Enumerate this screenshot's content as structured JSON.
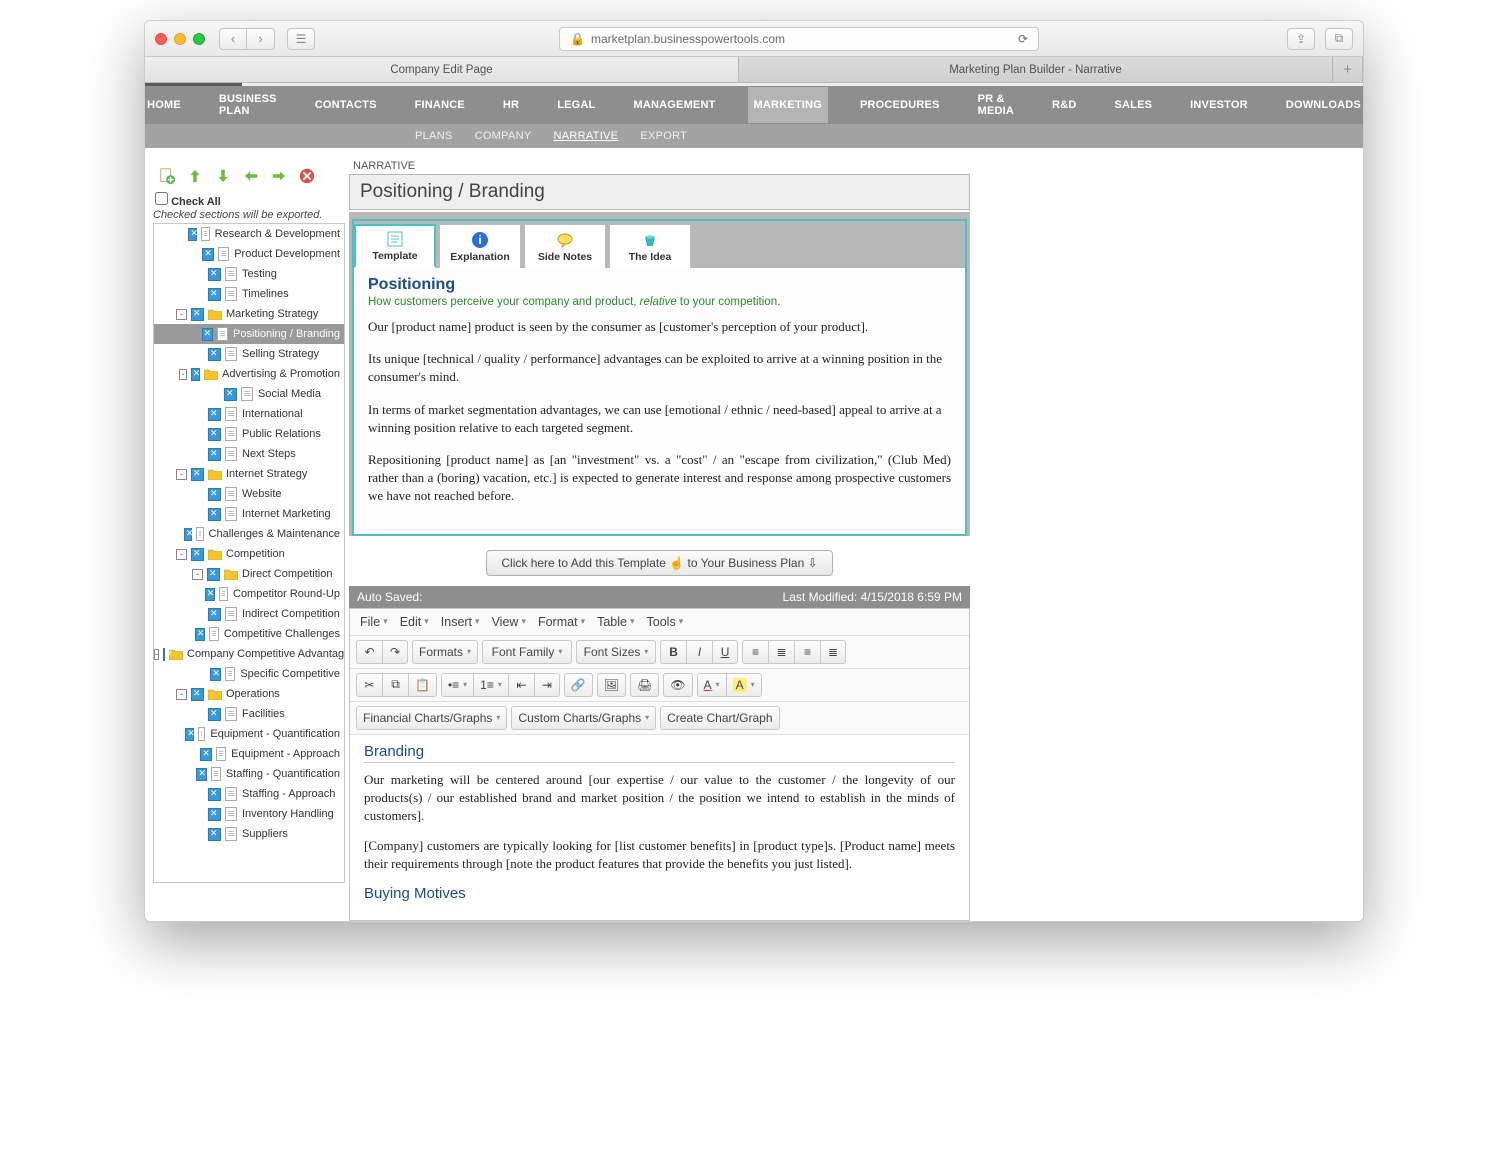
{
  "browser": {
    "url": "marketplan.businesspowertools.com",
    "tabs": [
      "Company Edit Page",
      "Marketing Plan Builder - Narrative"
    ]
  },
  "mainnav": [
    "HOME",
    "BUSINESS PLAN",
    "CONTACTS",
    "FINANCE",
    "HR",
    "LEGAL",
    "MANAGEMENT",
    "MARKETING",
    "PROCEDURES",
    "PR & MEDIA",
    "R&D",
    "SALES",
    "INVESTOR",
    "DOWNLOADS"
  ],
  "mainnav_active": 7,
  "subnav": [
    "PLANS",
    "COMPANY",
    "NARRATIVE",
    "EXPORT"
  ],
  "subnav_active": 2,
  "sidebar": {
    "check_all": "Check All",
    "hint": "Checked sections will be exported.",
    "tree": [
      {
        "d": 3,
        "t": "doc",
        "label": "Research & Development"
      },
      {
        "d": 3,
        "t": "doc",
        "label": "Product Development"
      },
      {
        "d": 3,
        "t": "doc",
        "label": "Testing"
      },
      {
        "d": 3,
        "t": "doc",
        "label": "Timelines"
      },
      {
        "d": 2,
        "t": "fold",
        "exp": "-",
        "label": "Marketing Strategy"
      },
      {
        "d": 3,
        "t": "doc",
        "label": "Positioning / Branding",
        "sel": true
      },
      {
        "d": 3,
        "t": "doc",
        "label": "Selling Strategy"
      },
      {
        "d": 3,
        "t": "fold",
        "exp": "-",
        "label": "Advertising & Promotion"
      },
      {
        "d": 4,
        "t": "doc",
        "label": "Social Media"
      },
      {
        "d": 3,
        "t": "doc",
        "label": "International"
      },
      {
        "d": 3,
        "t": "doc",
        "label": "Public Relations"
      },
      {
        "d": 3,
        "t": "doc",
        "label": "Next Steps"
      },
      {
        "d": 2,
        "t": "fold",
        "exp": "-",
        "label": "Internet Strategy"
      },
      {
        "d": 3,
        "t": "doc",
        "label": "Website"
      },
      {
        "d": 3,
        "t": "doc",
        "label": "Internet Marketing"
      },
      {
        "d": 3,
        "t": "doc",
        "label": "Challenges & Maintenance"
      },
      {
        "d": 2,
        "t": "fold",
        "exp": "-",
        "label": "Competition"
      },
      {
        "d": 3,
        "t": "fold",
        "exp": "-",
        "label": "Direct Competition"
      },
      {
        "d": 4,
        "t": "doc",
        "label": "Competitor Round-Up"
      },
      {
        "d": 3,
        "t": "doc",
        "label": "Indirect Competition"
      },
      {
        "d": 3,
        "t": "doc",
        "label": "Competitive Challenges"
      },
      {
        "d": 3,
        "t": "fold",
        "exp": "-",
        "label": "Company Competitive Advantages"
      },
      {
        "d": 4,
        "t": "doc",
        "label": "Specific Competitive"
      },
      {
        "d": 2,
        "t": "fold",
        "exp": "-",
        "label": "Operations"
      },
      {
        "d": 3,
        "t": "doc",
        "label": "Facilities"
      },
      {
        "d": 3,
        "t": "doc",
        "label": "Equipment - Quantification"
      },
      {
        "d": 3,
        "t": "doc",
        "label": "Equipment - Approach"
      },
      {
        "d": 3,
        "t": "doc",
        "label": "Staffing - Quantification"
      },
      {
        "d": 3,
        "t": "doc",
        "label": "Staffing - Approach"
      },
      {
        "d": 3,
        "t": "doc",
        "label": "Inventory Handling"
      },
      {
        "d": 3,
        "t": "doc",
        "label": "Suppliers"
      }
    ]
  },
  "page": {
    "narrative_label": "NARRATIVE",
    "title": "Positioning / Branding",
    "tabs": [
      "Template",
      "Explanation",
      "Side Notes",
      "The Idea"
    ],
    "section_heading": "Positioning",
    "section_hint_a": "How customers perceive your company and product, ",
    "section_hint_i": "relative",
    "section_hint_b": " to your competition.",
    "p1": "Our [product name] product is seen by the consumer as [customer's perception of your product].",
    "p2": "Its unique [technical / quality / performance] advantages can be exploited to arrive at a winning position in the consumer's mind.",
    "p3": "In terms of market segmentation advantages, we can use [emotional / ethnic / need-based] appeal to arrive at a winning position relative to each targeted segment.",
    "p4": "Repositioning [product name] as [an \"investment\" vs. a \"cost\" / an \"escape from civilization,\" (Club Med) rather than a (boring) vacation, etc.] is expected to generate interest and response among prospective customers we have not reached before.",
    "add_button": "Click here to Add this Template ☝ to Your Business Plan ⇩"
  },
  "status": {
    "left": "Auto Saved:",
    "right": "Last Modified: 4/15/2018 6:59 PM"
  },
  "editor": {
    "menus": [
      "File",
      "Edit",
      "Insert",
      "View",
      "Format",
      "Table",
      "Tools"
    ],
    "formats": "Formats",
    "fontfamily": "Font Family",
    "fontsizes": "Font Sizes",
    "charts1": "Financial Charts/Graphs",
    "charts2": "Custom Charts/Graphs",
    "charts3": "Create Chart/Graph",
    "h1": "Branding",
    "bp1": "Our marketing will be centered around [our expertise / our value to the customer / the longevity of our products(s) / our established brand and market position / the position we intend to establish in the minds of customers].",
    "bp2": "[Company] customers are typically looking for [list customer benefits] in [product type]s. [Product name] meets their requirements through [note the product features that provide the benefits you just listed].",
    "h2": "Buying Motives"
  }
}
